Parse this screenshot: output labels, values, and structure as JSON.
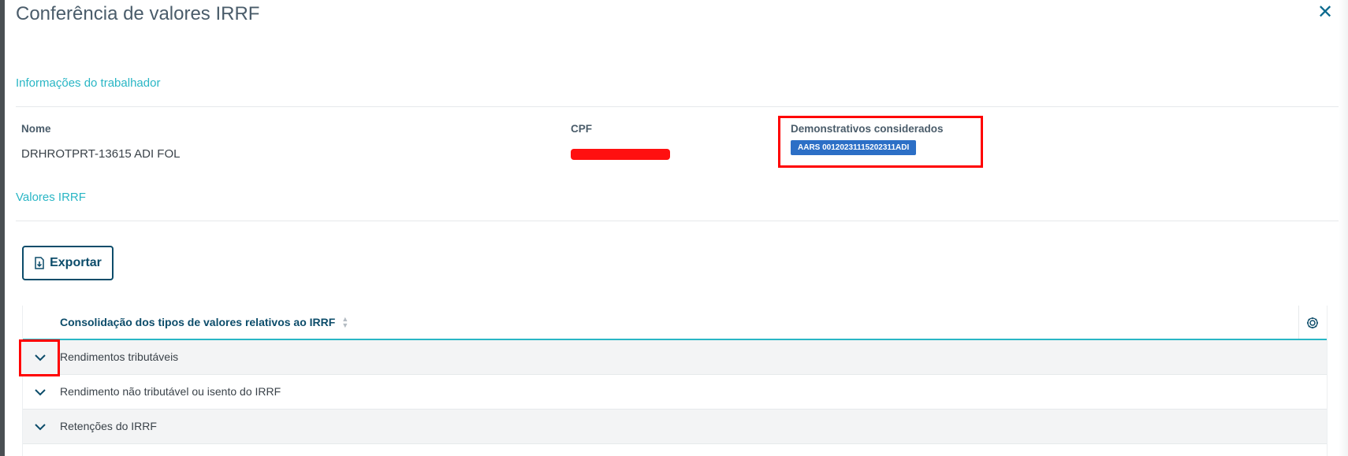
{
  "dialog": {
    "title": "Conferência de valores IRRF",
    "close_icon": "close-icon"
  },
  "worker_section": {
    "title": "Informações do trabalhador",
    "fields": {
      "name_label": "Nome",
      "name_value": "DRHROTPRT-13615 ADI FOL",
      "cpf_label": "CPF",
      "statements_label": "Demonstrativos considerados",
      "statement_tag": "AARS 00120231115202311ADI"
    }
  },
  "values_section": {
    "title": "Valores IRRF",
    "export_label": "Exportar",
    "export_icon": "file-export-icon"
  },
  "table": {
    "header": "Consolidação dos tipos de valores relativos ao IRRF",
    "sort_icon": "sort-icon",
    "settings_icon": "gear-icon",
    "rows": [
      {
        "label": "Rendimentos tributáveis"
      },
      {
        "label": "Rendimento não tributável ou isento do IRRF"
      },
      {
        "label": "Retenções do IRRF"
      }
    ]
  },
  "colors": {
    "accent": "#29b6c5",
    "primary": "#0c4c6a",
    "tag": "#2c6fc6",
    "annotation": "#ff0000"
  }
}
